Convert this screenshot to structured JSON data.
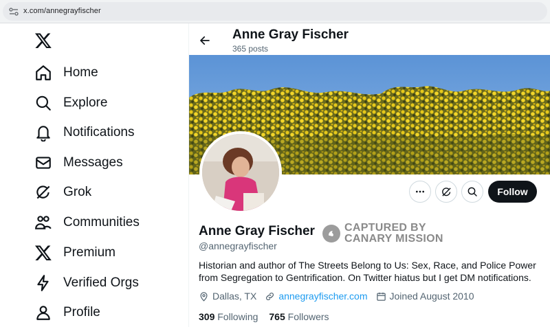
{
  "browser": {
    "url": "x.com/annegrayfischer"
  },
  "nav": {
    "items": [
      {
        "label": "Home",
        "icon": "home-icon"
      },
      {
        "label": "Explore",
        "icon": "search-icon"
      },
      {
        "label": "Notifications",
        "icon": "bell-icon"
      },
      {
        "label": "Messages",
        "icon": "envelope-icon"
      },
      {
        "label": "Grok",
        "icon": "grok-icon"
      },
      {
        "label": "Communities",
        "icon": "communities-icon"
      },
      {
        "label": "Premium",
        "icon": "x-logo-icon"
      },
      {
        "label": "Verified Orgs",
        "icon": "lightning-icon"
      },
      {
        "label": "Profile",
        "icon": "person-icon"
      }
    ]
  },
  "header": {
    "name": "Anne Gray Fischer",
    "posts": "365 posts"
  },
  "profile": {
    "name": "Anne Gray Fischer",
    "handle": "@annegrayfischer",
    "bio": "Historian and author of The Streets Belong to Us: Sex, Race, and Police Power from Segregation to Gentrification. On Twitter hiatus but I get DM notifications.",
    "location": "Dallas, TX",
    "website": "annegrayfischer.com",
    "joined": "Joined August 2010",
    "following_count": "309",
    "following_label": "Following",
    "followers_count": "765",
    "followers_label": "Followers",
    "follow_label": "Follow"
  },
  "watermark": {
    "line1": "CAPTURED BY",
    "line2": "CANARY MISSION"
  },
  "colors": {
    "accent": "#1d9bf0",
    "text": "#0f1419",
    "muted": "#536471",
    "follow_bg": "#0f1419"
  }
}
